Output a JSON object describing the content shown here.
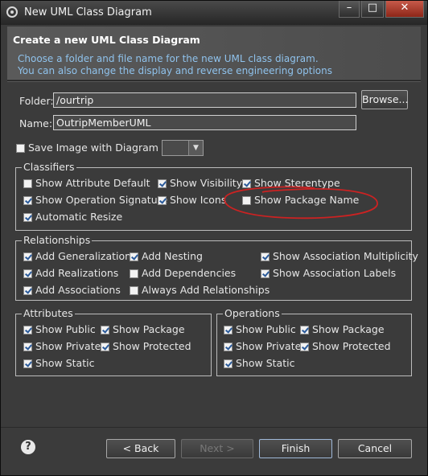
{
  "window": {
    "title": "New UML Class Diagram"
  },
  "header": {
    "title": "Create a new UML Class Diagram",
    "description_line1": "Choose a folder and file name for the new UML class diagram.",
    "description_line2": "You can also change the display and reverse engineering options"
  },
  "form": {
    "folder_label": "Folder:",
    "folder_value": "/ourtrip",
    "browse_label": "Browse...",
    "name_label": "Name:",
    "name_value": "OutripMemberUML",
    "save_image_label": "Save Image with Diagram as",
    "save_image_checked": false,
    "format_value": ""
  },
  "classifiers": {
    "title": "Classifiers",
    "show_attribute_default": "Show Attribute Default",
    "show_visibility": "Show Visibility",
    "show_stereotype": "Show Sterentype",
    "show_operation_signature": "Show Operation Signature",
    "show_icons": "Show Icons",
    "show_package_name": "Show Package Name",
    "automatic_resize": "Automatic Resize"
  },
  "relationships": {
    "title": "Relationships",
    "add_generalizations": "Add Generalizations",
    "add_nesting": "Add Nesting",
    "show_assoc_multiplicity": "Show Association Multiplicity",
    "add_realizations": "Add Realizations",
    "add_dependencies": "Add Dependencies",
    "show_assoc_labels": "Show Association Labels",
    "add_associations": "Add Associations",
    "always_add_relationships": "Always Add Relationships"
  },
  "attributes": {
    "title": "Attributes",
    "show_public": "Show Public",
    "show_package": "Show Package",
    "show_private": "Show Private",
    "show_protected": "Show Protected",
    "show_static": "Show Static"
  },
  "operations": {
    "title": "Operations",
    "show_public": "Show Public",
    "show_package": "Show Package",
    "show_private": "Show Private",
    "show_protected": "Show Protected",
    "show_static": "Show Static"
  },
  "buttons": {
    "back": "< Back",
    "next": "Next >",
    "finish": "Finish",
    "cancel": "Cancel"
  },
  "colors": {
    "annotation": "#cc2222",
    "header_text": "#8fc2ec"
  }
}
